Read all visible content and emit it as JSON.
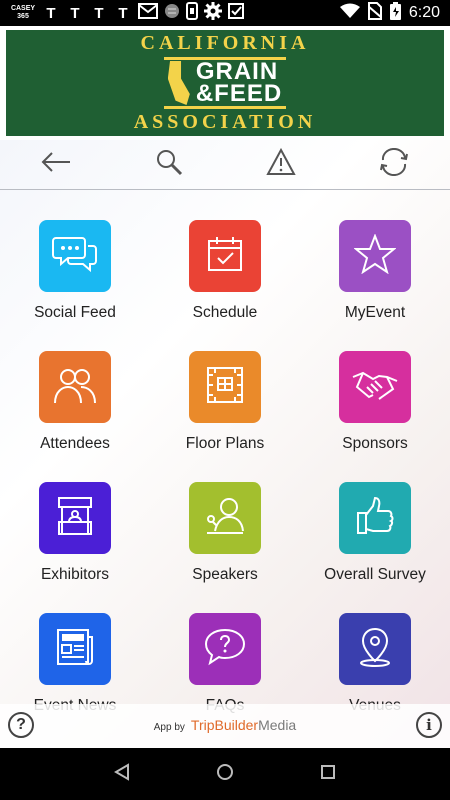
{
  "status_bar": {
    "carrier_badge": "CASEY 365",
    "left_glyphs": [
      "T",
      "T",
      "T",
      "T"
    ],
    "time": "6:20",
    "icons": [
      "mail-icon",
      "globe-icon",
      "phone-icon",
      "settings-icon",
      "tasks-icon",
      "wifi-icon",
      "no-sim-icon",
      "battery-icon"
    ]
  },
  "banner": {
    "line1": "CALIFORNIA",
    "word_grain": "GRAIN",
    "word_feed": "&FEED",
    "line3": "ASSOCIATION",
    "colors": {
      "background": "#1f5f33",
      "accent": "#f3d34a"
    }
  },
  "toolbar": {
    "buttons": [
      "back-arrow-icon",
      "search-icon",
      "alert-icon",
      "refresh-icon"
    ]
  },
  "tiles": [
    {
      "label": "Social Feed",
      "icon": "chat-bubbles-icon",
      "color": "#1ab8f2"
    },
    {
      "label": "Schedule",
      "icon": "calendar-icon",
      "color": "#ea4335"
    },
    {
      "label": "MyEvent",
      "icon": "star-icon",
      "color": "#9b50c4"
    },
    {
      "label": "Attendees",
      "icon": "people-icon",
      "color": "#e8742f"
    },
    {
      "label": "Floor Plans",
      "icon": "floor-plan-icon",
      "color": "#ea8a2a"
    },
    {
      "label": "Sponsors",
      "icon": "handshake-icon",
      "color": "#d62f9e"
    },
    {
      "label": "Exhibitors",
      "icon": "booth-icon",
      "color": "#4b1fd6"
    },
    {
      "label": "Speakers",
      "icon": "speaker-icon",
      "color": "#a3bf2e"
    },
    {
      "label": "Overall Survey",
      "icon": "thumbs-up-icon",
      "color": "#21aab0"
    },
    {
      "label": "Event News",
      "icon": "news-icon",
      "color": "#1f64e8"
    },
    {
      "label": "FAQs",
      "icon": "question-bubble-icon",
      "color": "#9c2fb8"
    },
    {
      "label": "Venues",
      "icon": "location-pin-icon",
      "color": "#3a3fae"
    }
  ],
  "footer": {
    "help": "?",
    "info": "i",
    "credit_prefix": "App by",
    "credit_brand": "TripBuilder",
    "credit_media": "Media"
  },
  "nav_bar": {
    "buttons": [
      "back-triangle-icon",
      "home-circle-icon",
      "recents-square-icon"
    ]
  }
}
